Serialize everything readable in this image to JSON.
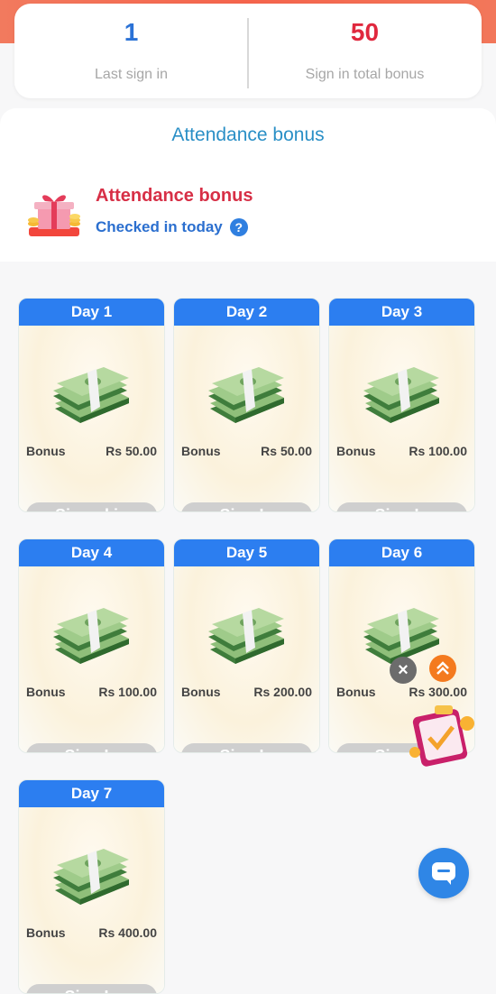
{
  "stats": {
    "last_sign_in_value": "1",
    "last_sign_in_label": "Last sign in",
    "total_bonus_value": "50",
    "total_bonus_label": "Sign in total bonus"
  },
  "attendance": {
    "section_title": "Attendance bonus",
    "heading": "Attendance bonus",
    "status": "Checked in today",
    "help_icon_text": "?"
  },
  "days": [
    {
      "day": "Day 1",
      "bonus_label": "Bonus",
      "bonus_value": "Rs 50.00",
      "button": "Signed in"
    },
    {
      "day": "Day 2",
      "bonus_label": "Bonus",
      "bonus_value": "Rs 50.00",
      "button": "Sign In"
    },
    {
      "day": "Day 3",
      "bonus_label": "Bonus",
      "bonus_value": "Rs 100.00",
      "button": "Sign In"
    },
    {
      "day": "Day 4",
      "bonus_label": "Bonus",
      "bonus_value": "Rs 100.00",
      "button": "Sign In"
    },
    {
      "day": "Day 5",
      "bonus_label": "Bonus",
      "bonus_value": "Rs 200.00",
      "button": "Sign In"
    },
    {
      "day": "Day 6",
      "bonus_label": "Bonus",
      "bonus_value": "Rs 300.00",
      "button": "Sign In"
    },
    {
      "day": "Day 7",
      "bonus_label": "Bonus",
      "bonus_value": "Rs 400.00",
      "button": "Sign In"
    }
  ],
  "icons": {
    "gift": "gift-icon",
    "money": "money-stack-icon",
    "close": "close-icon",
    "scroll_up": "double-chevron-up-icon",
    "promo": "gift-box-promo-icon",
    "chat": "chat-icon"
  },
  "colors": {
    "day_header": "#2c7ef0",
    "accent_red": "#e0283e",
    "accent_blue": "#2b72d6"
  }
}
